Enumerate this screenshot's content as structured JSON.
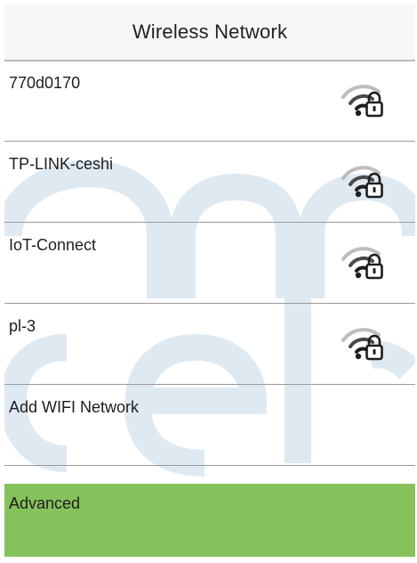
{
  "header": {
    "title": "Wireless Network"
  },
  "networks": [
    {
      "ssid": "770d0170",
      "icon": "wifi-lock-icon",
      "secured": true
    },
    {
      "ssid": "TP-LINK-ceshi",
      "icon": "wifi-lock-icon",
      "secured": true
    },
    {
      "ssid": "IoT-Connect",
      "icon": "wifi-lock-icon",
      "secured": true
    },
    {
      "ssid": "pl-3",
      "icon": "wifi-lock-icon",
      "secured": true
    }
  ],
  "actions": {
    "add_network_label": "Add WIFI Network",
    "advanced_label": "Advanced"
  },
  "colors": {
    "accent_selected": "#86c25b",
    "watermark": "#dfe9f2",
    "icon_stroke": "#1e1e1e",
    "icon_muted": "#bdbdbd"
  }
}
